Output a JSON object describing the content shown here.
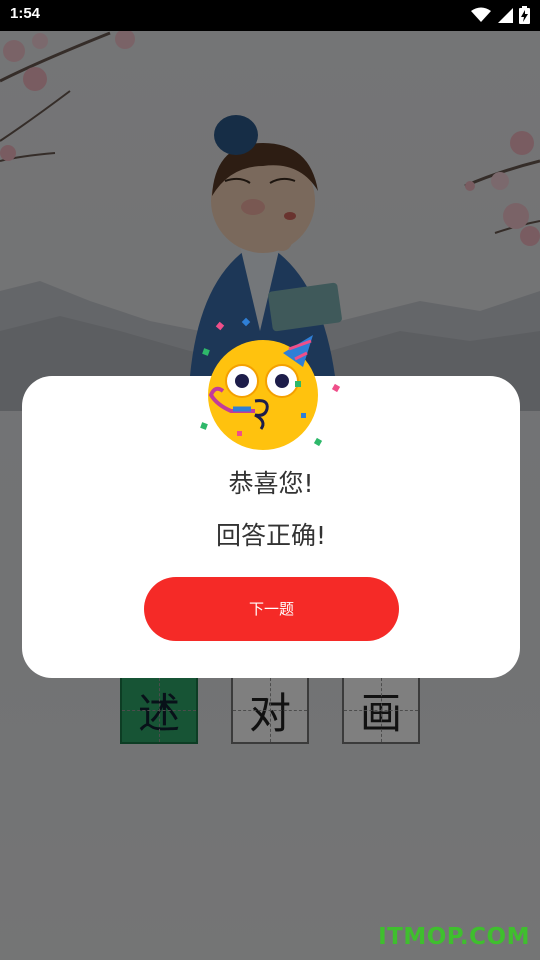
{
  "status_bar": {
    "time": "1:54",
    "icons": [
      "wifi-icon",
      "signal-icon",
      "battery-charging-icon"
    ]
  },
  "answer_tiles": [
    {
      "char": "述",
      "state": "correct"
    },
    {
      "char": "对",
      "state": "normal"
    },
    {
      "char": "画",
      "state": "normal"
    }
  ],
  "dialog": {
    "title": "恭喜您!",
    "message": "回答正确!",
    "next_button_label": "下一题"
  },
  "watermark": "ITMOP.COM",
  "colors": {
    "primary_button": "#f52a27",
    "correct_tile": "#2ea86a",
    "watermark": "#3fbf2e",
    "emoji_face": "#ffc20e"
  }
}
